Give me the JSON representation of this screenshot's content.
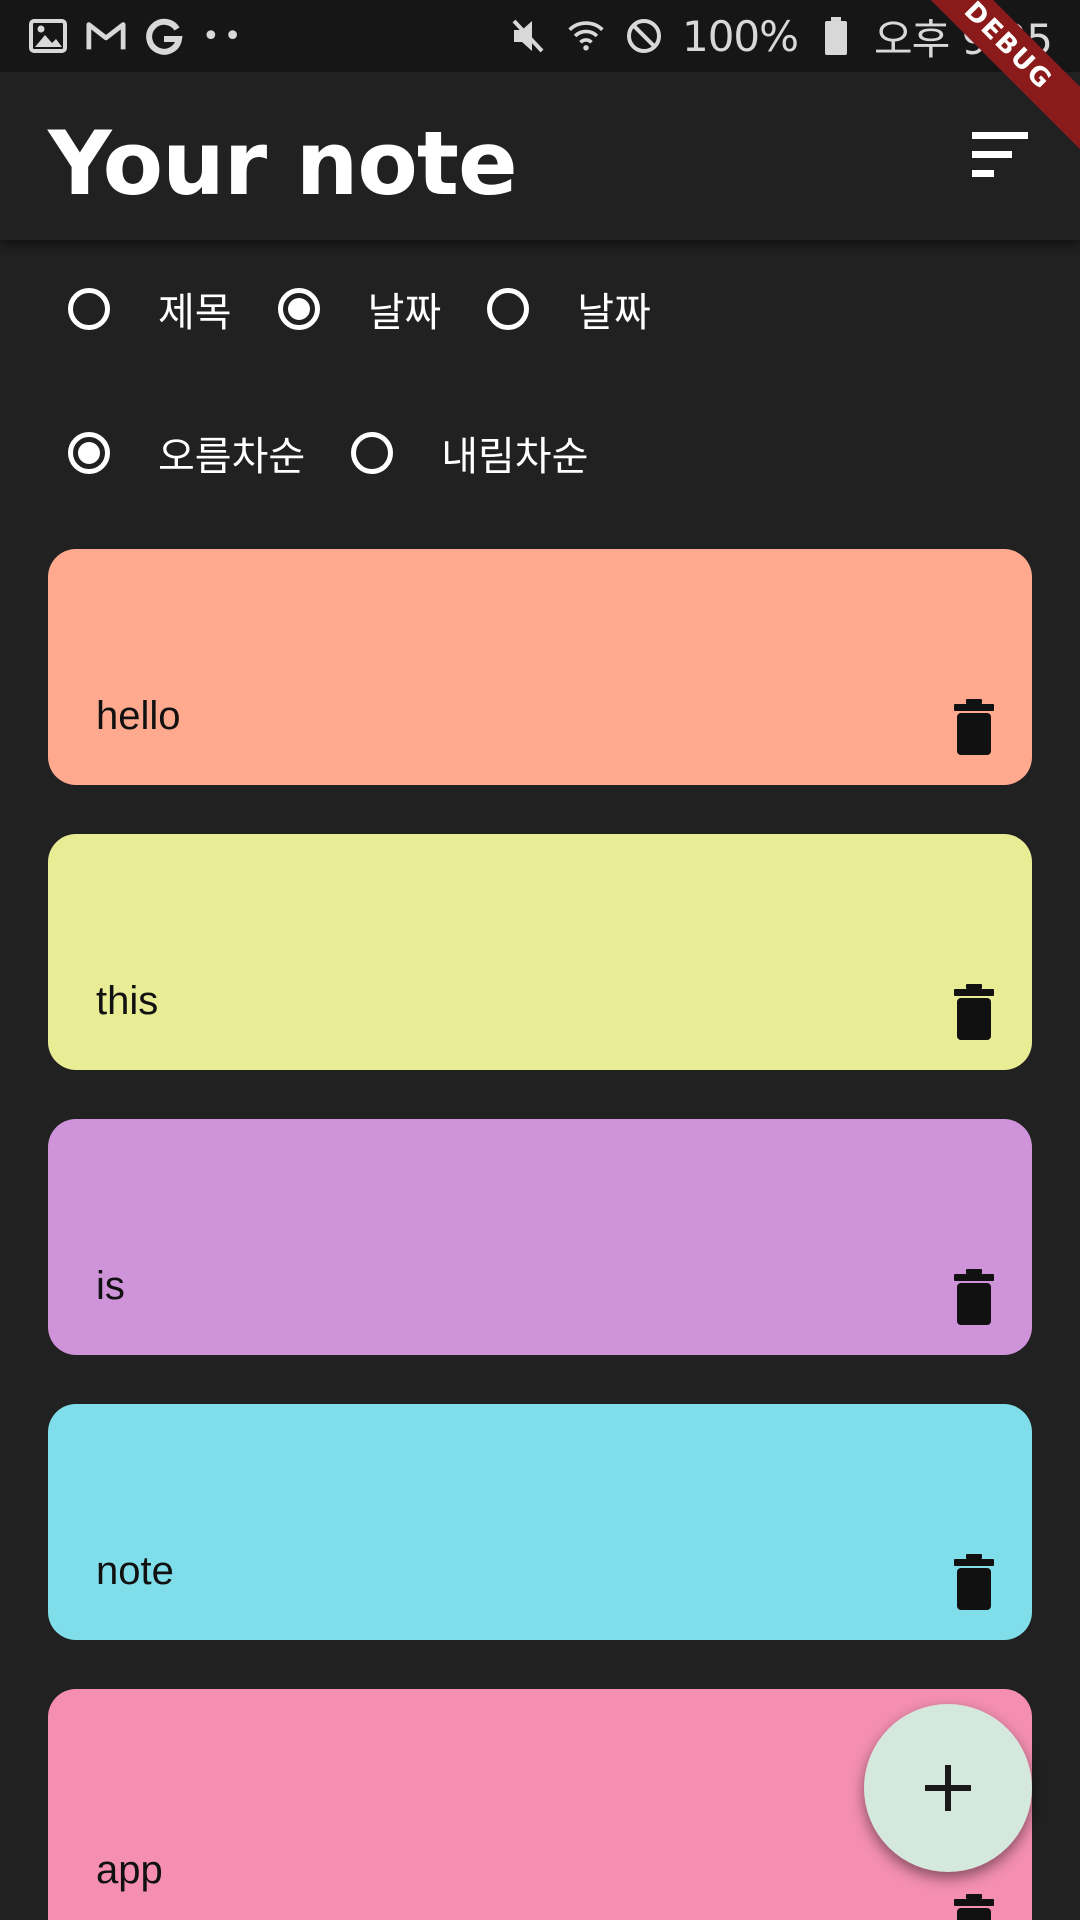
{
  "status_bar": {
    "battery": "100%",
    "time": "오후 9:25"
  },
  "app_bar": {
    "title": "Your note",
    "sort_icon": "sort-icon"
  },
  "debug_banner": "DEBUG",
  "sort_options": {
    "field": [
      {
        "label": "제목",
        "selected": false
      },
      {
        "label": "날짜",
        "selected": true
      },
      {
        "label": "날짜",
        "selected": false
      }
    ],
    "order": [
      {
        "label": "오름차순",
        "selected": true
      },
      {
        "label": "내림차순",
        "selected": false
      }
    ]
  },
  "notes": [
    {
      "title": "hello",
      "color": "#FFAA8F"
    },
    {
      "title": "this",
      "color": "#E7EC95"
    },
    {
      "title": "is",
      "color": "#CF93D9"
    },
    {
      "title": "note",
      "color": "#80DEEA"
    },
    {
      "title": "app",
      "color": "#F48FB1"
    }
  ],
  "fab": {
    "icon": "add-icon"
  },
  "colors": {
    "background": "#212121",
    "status_bar": "#161616",
    "fab": "#D5E8DE",
    "debug": "#8B1A1A"
  }
}
